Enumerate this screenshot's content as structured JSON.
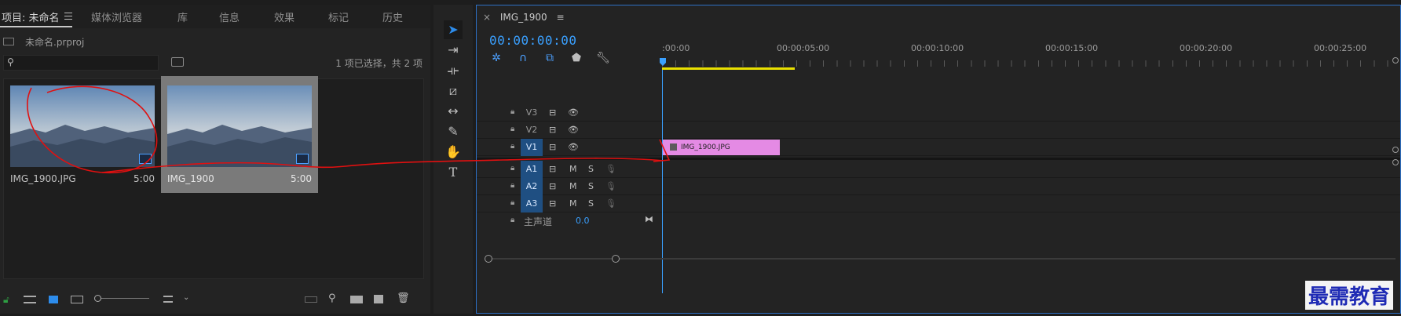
{
  "project_panel": {
    "tabs": [
      {
        "label": "项目: 未命名",
        "active": true
      },
      {
        "label": "媒体浏览器"
      },
      {
        "label": "库"
      },
      {
        "label": "信息"
      },
      {
        "label": "效果"
      },
      {
        "label": "标记"
      },
      {
        "label": "历史"
      }
    ],
    "project_file": "未命名.prproj",
    "selection_status": "1 项已选择，共 2 项",
    "clips": [
      {
        "name": "IMG_1900.JPG",
        "duration": "5:00",
        "selected": false
      },
      {
        "name": "IMG_1900",
        "duration": "5:00",
        "selected": true
      }
    ]
  },
  "timeline": {
    "sequence_name": "IMG_1900",
    "timecode": "00:00:00:00",
    "ruler_labels": [
      ":00:00",
      "00:00:05:00",
      "00:00:10:00",
      "00:00:15:00",
      "00:00:20:00",
      "00:00:25:00"
    ],
    "video_tracks": [
      "V3",
      "V2",
      "V1"
    ],
    "audio_tracks": [
      "A1",
      "A2",
      "A3"
    ],
    "mute_label": "M",
    "solo_label": "S",
    "master": {
      "label": "主声道",
      "value": "0.0"
    },
    "clip_on_v1": "IMG_1900.JPG"
  },
  "watermark": "最需教育",
  "colors": {
    "accent": "#3aa0ff",
    "clip_pink": "#e48ae4",
    "work_area": "#e9e000",
    "annotation": "#e01010"
  }
}
